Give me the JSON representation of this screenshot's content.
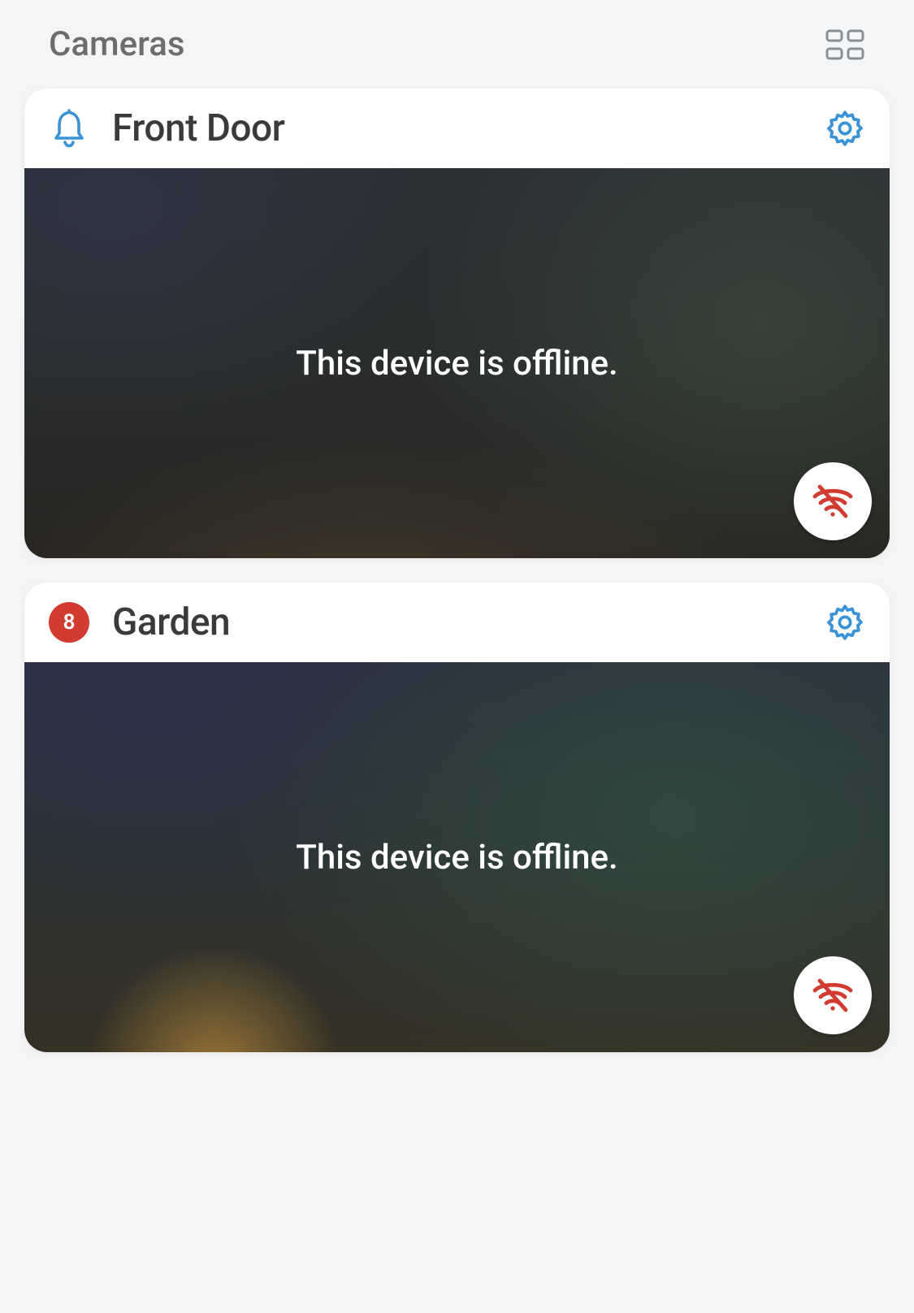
{
  "header": {
    "title": "Cameras"
  },
  "colors": {
    "accent": "#3a93d6",
    "badge": "#d23b30",
    "wifiOff": "#d23b30"
  },
  "cameras": [
    {
      "name": "Front Door",
      "status_text": "This device is offline.",
      "left_icon": "bell",
      "badge": null,
      "offline": true
    },
    {
      "name": "Garden",
      "status_text": "This device is offline.",
      "left_icon": null,
      "badge": "8",
      "offline": true
    }
  ]
}
